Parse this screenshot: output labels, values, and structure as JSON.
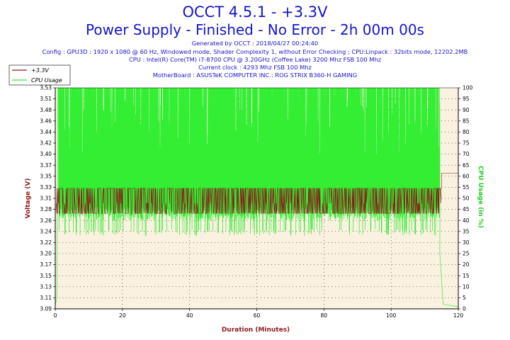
{
  "header": {
    "title": "OCCT 4.5.1 - +3.3V",
    "subtitle": "Power Supply - Finished - No Error - 2h 00m 00s",
    "info_lines": [
      "Generated by OCCT : 2018/04/27 00:24:40",
      "Config : GPU3D : 1920 x 1080 @ 60 Hz, Windowed mode, Shader Complexity 1, without Error Checking ; CPU:Linpack : 32bits mode, 12202.2MB",
      "CPU : Intel(R) Core(TM) i7-8700 CPU @ 3.20GHz (Coffee Lake) 3200 Mhz FSB 100 Mhz",
      "Current clock : 4293 Mhz FSB 100 Mhz",
      "MotherBoard : ASUSTeK COMPUTER INC.: ROG STRIX B360-H GAMING"
    ]
  },
  "chart_data": {
    "type": "line",
    "xlabel": "Duration (Minutes)",
    "ylabel_left": "Voltage (V)",
    "ylabel_right": "CPU Usage (in %)",
    "xlim": [
      0,
      120
    ],
    "ylim_left": [
      3.09,
      3.53
    ],
    "ylim_right": [
      0,
      100
    ],
    "x_ticks": [
      "0",
      "20",
      "40",
      "60",
      "80",
      "100",
      "120"
    ],
    "y_left_ticks": [
      "3.09",
      "3.11",
      "3.13",
      "3.15",
      "3.17",
      "3.20",
      "3.22",
      "3.24",
      "3.26",
      "3.28",
      "3.31",
      "3.33",
      "3.35",
      "3.37",
      "3.40",
      "3.42",
      "3.44",
      "3.46",
      "3.48",
      "3.51",
      "3.53"
    ],
    "y_right_ticks": [
      "0",
      "5",
      "10",
      "15",
      "20",
      "25",
      "30",
      "35",
      "40",
      "45",
      "50",
      "55",
      "60",
      "65",
      "70",
      "75",
      "80",
      "85",
      "90",
      "95",
      "100"
    ],
    "grid": true,
    "legend_position": "top-left",
    "series": [
      {
        "name": "+3.3V",
        "axis": "left",
        "color": "#8b1a1a",
        "pattern": "oscillating",
        "range": [
          3.28,
          3.33
        ],
        "mean": 3.3,
        "active_until": 115,
        "final_value": 3.36
      },
      {
        "name": "CPU Usage",
        "axis": "right",
        "color": "#33ee33",
        "pattern": "oscillating",
        "range": [
          35,
          100
        ],
        "start": [
          [
            0,
            2
          ],
          [
            0.5,
            5
          ],
          [
            0.8,
            100
          ]
        ],
        "active_until": 114.5,
        "end": [
          [
            114.5,
            25
          ],
          [
            115.5,
            2
          ],
          [
            120,
            1
          ]
        ]
      }
    ],
    "colors": {
      "background": "#faf1e0",
      "grid": "#000000",
      "title": "#1515cc",
      "axis_label_x": "#8b1a1a",
      "axis_label_left": "#8b1a1a",
      "axis_label_right": "#22cc22"
    }
  }
}
